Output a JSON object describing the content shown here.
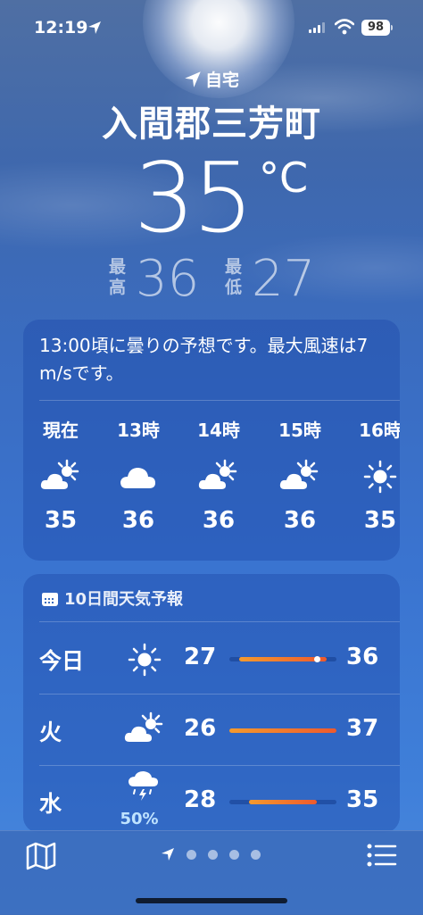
{
  "status_bar": {
    "time": "12:19",
    "battery": "98"
  },
  "header": {
    "location_label": "自宅",
    "city": "入間郡三芳町",
    "temperature": "35",
    "unit": "°C",
    "high_label": "最高",
    "high": "36",
    "low_label": "最低",
    "low": "27"
  },
  "hourly": {
    "summary": "13:00頃に曇りの予想です。最大風速は7 m/sです。",
    "items": [
      {
        "label": "現在",
        "icon": "partly-cloudy-icon",
        "temp": "35"
      },
      {
        "label": "13時",
        "icon": "cloud-icon",
        "temp": "36"
      },
      {
        "label": "14時",
        "icon": "partly-cloudy-icon",
        "temp": "36"
      },
      {
        "label": "15時",
        "icon": "partly-cloudy-icon",
        "temp": "36"
      },
      {
        "label": "16時",
        "icon": "sun-icon",
        "temp": "35"
      }
    ]
  },
  "daily": {
    "title": "10日間天気予報",
    "range": [
      26,
      37
    ],
    "items": [
      {
        "day": "今日",
        "icon": "sun-icon",
        "low": "27",
        "high": "36",
        "low_value": 27,
        "high_value": 36,
        "current_value": 35
      },
      {
        "day": "火",
        "icon": "partly-cloudy-icon",
        "low": "26",
        "high": "37",
        "low_value": 26,
        "high_value": 37
      },
      {
        "day": "水",
        "icon": "thunder-rain-icon",
        "precip": "50%",
        "low": "28",
        "high": "35",
        "low_value": 28,
        "high_value": 35
      }
    ]
  },
  "colors": {
    "bar_start": "#f49a2e",
    "bar_end": "#ee5a2e",
    "precip": "#bfe3ff"
  }
}
